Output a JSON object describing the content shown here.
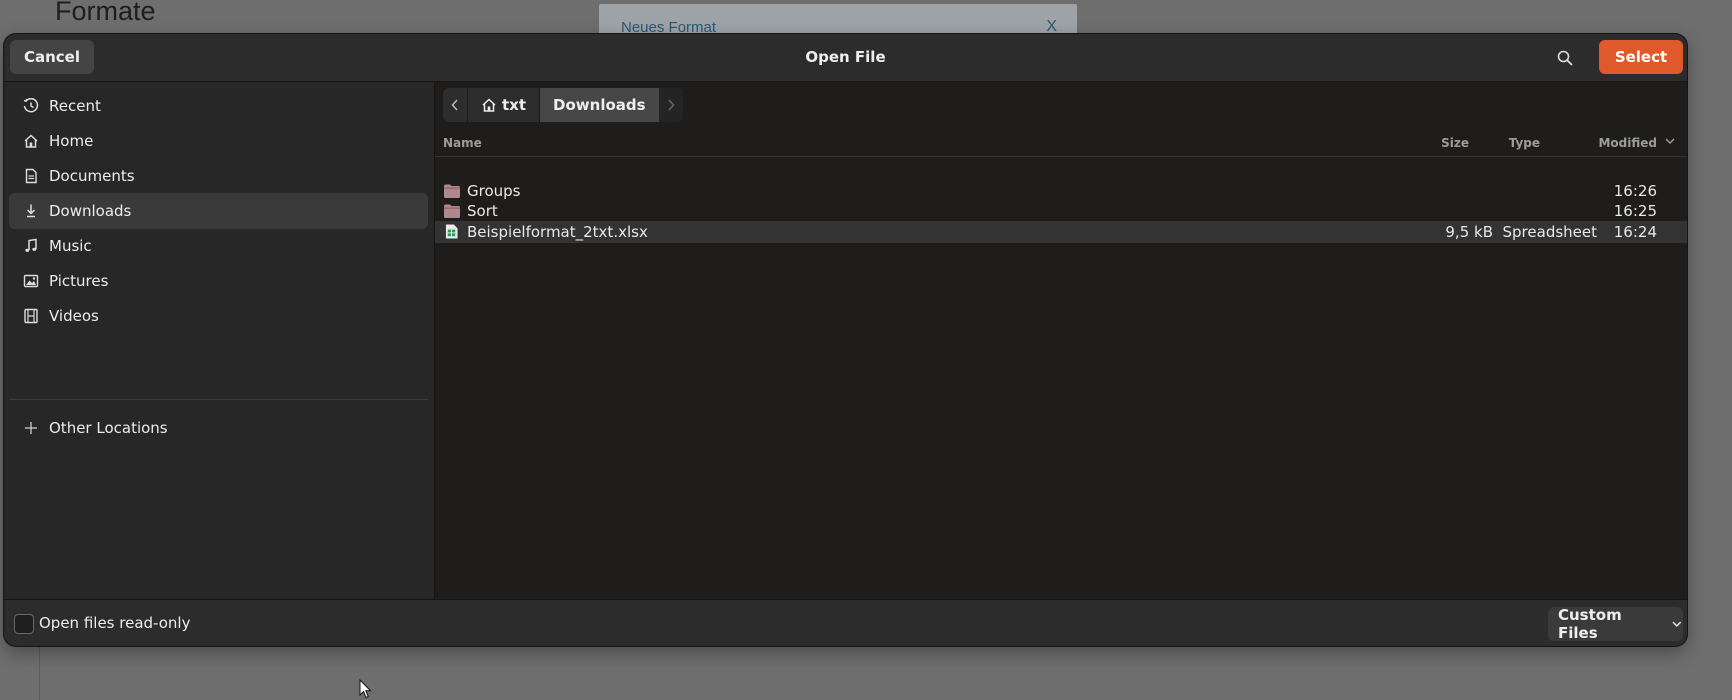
{
  "background": {
    "page_title": "Formate",
    "modal_title": "Neues Format",
    "modal_close": "X"
  },
  "dialog": {
    "title": "Open File",
    "cancel_label": "Cancel",
    "select_label": "Select"
  },
  "sidebar": {
    "items": [
      {
        "label": "Recent",
        "icon": "clock-icon"
      },
      {
        "label": "Home",
        "icon": "home-icon"
      },
      {
        "label": "Documents",
        "icon": "document-icon"
      },
      {
        "label": "Downloads",
        "icon": "download-icon",
        "active": true
      },
      {
        "label": "Music",
        "icon": "music-note-icon"
      },
      {
        "label": "Pictures",
        "icon": "picture-icon"
      },
      {
        "label": "Videos",
        "icon": "film-icon"
      }
    ],
    "other_locations": {
      "label": "Other Locations",
      "icon": "plus-icon"
    }
  },
  "pathbar": {
    "segments": [
      {
        "label": "txt",
        "icon": "home-icon"
      },
      {
        "label": "Downloads",
        "current": true
      }
    ]
  },
  "columns": {
    "name": "Name",
    "size": "Size",
    "type": "Type",
    "modified": "Modified"
  },
  "files": [
    {
      "name": "Groups",
      "kind": "folder",
      "size": "",
      "type": "",
      "modified": "16:26"
    },
    {
      "name": "Sort",
      "kind": "folder",
      "size": "",
      "type": "",
      "modified": "16:25"
    },
    {
      "name": "Beispielformat_2txt.xlsx",
      "kind": "spreadsheet",
      "size": "9,5 kB",
      "type": "Spreadsheet",
      "modified": "16:24",
      "selected": true
    }
  ],
  "footer": {
    "read_only_label": "Open files read-only",
    "read_only_checked": false,
    "filter_label": "Custom Files"
  },
  "colors": {
    "accent": "#e0592a",
    "folder": "#b0888c",
    "spreadsheet": "#2e9a55"
  }
}
